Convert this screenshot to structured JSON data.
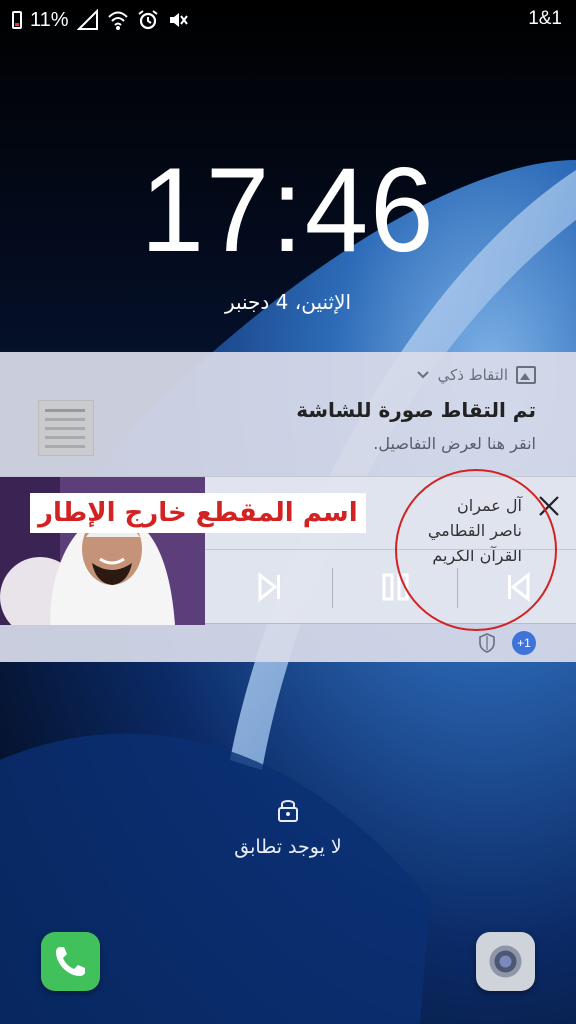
{
  "status_bar": {
    "battery": "11%",
    "carrier": "1&1",
    "icons": [
      "battery-icon",
      "signal-icon",
      "wifi-icon",
      "alarm-icon",
      "mute-icon"
    ]
  },
  "lockscreen": {
    "time": "17:46",
    "date": "الإثنين، 4 دجنبر",
    "unlock_hint": "لا يوجد تطابق"
  },
  "notifications": {
    "screenshot": {
      "app_name": "التقاط ذكي",
      "title": "تم التقاط صورة للشاشة",
      "subtitle": "انقر هنا لعرض التفاصيل."
    },
    "music": {
      "overlay_caption": "اسم المقطع خارج الإطار",
      "lines": [
        "آل عمران",
        "ناصر القطامي",
        "القرآن الكريم"
      ],
      "controls": [
        "next",
        "pause",
        "previous"
      ]
    },
    "footer": {
      "more_count": "+1"
    }
  },
  "colors": {
    "accent_red": "#d32222",
    "phone_green": "#41c15b",
    "badge_blue": "#3f73d9"
  }
}
